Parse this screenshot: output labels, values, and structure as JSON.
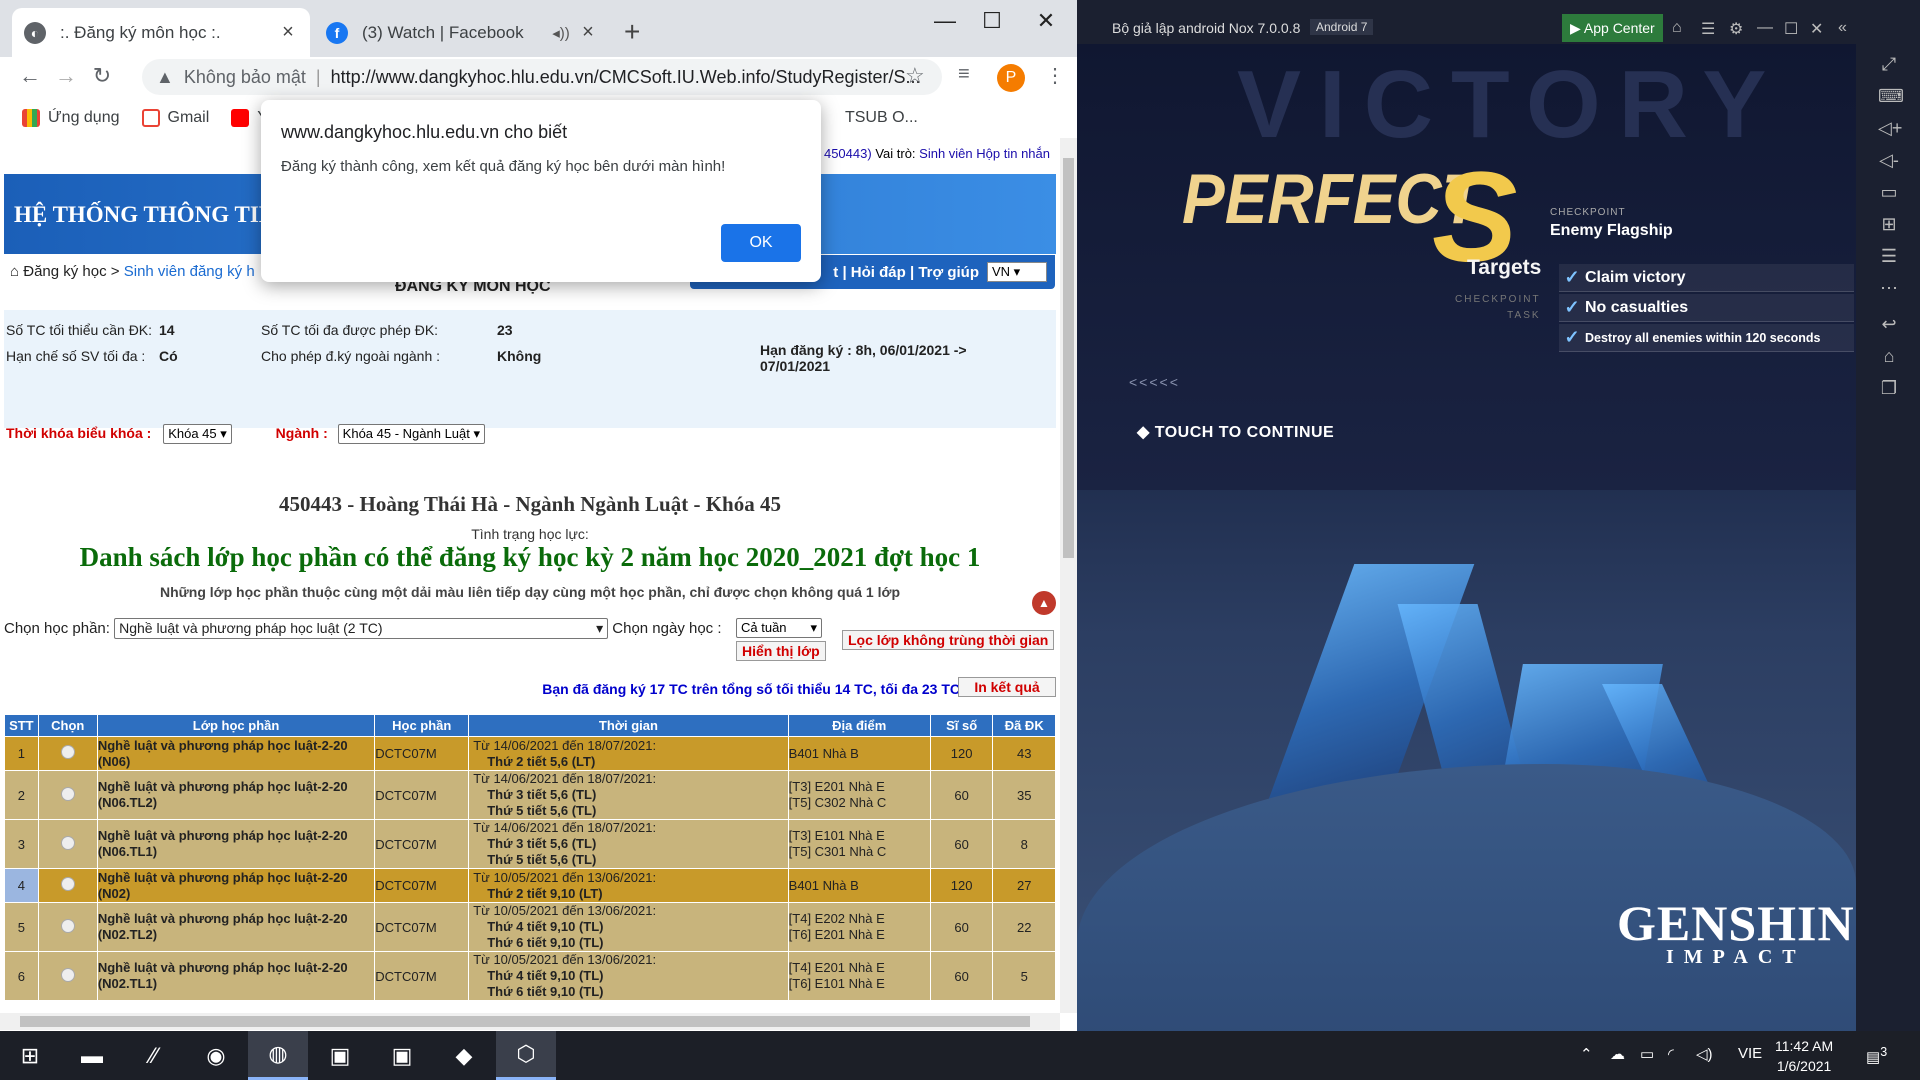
{
  "browser": {
    "tabs": [
      {
        "title": ":. Đăng ký môn học :.",
        "icon": "page-icon"
      },
      {
        "title": "(3) Watch | Facebook",
        "icon": "facebook-icon"
      }
    ],
    "omnibox": {
      "security": "Không bảo mật",
      "url": "http://www.dangkyhoc.hlu.edu.vn/CMCSoft.IU.Web.info/StudyRegister/S..."
    },
    "profile_initial": "P",
    "bookmarks": [
      {
        "label": "Ứng dụng",
        "icon": "apps-grid-icon"
      },
      {
        "label": "Gmail",
        "icon": "gmail-icon"
      },
      {
        "label": "Y",
        "icon": "youtube-icon"
      }
    ],
    "bookmark_tail": "TSUB O..."
  },
  "dialog": {
    "host": "www.dangkyhoc.hlu.edu.vn cho biết",
    "message": "Đăng ký thành công, xem kết quả đăng ký học bên dưới màn hình!",
    "ok": "OK"
  },
  "page": {
    "header_info_id": "450443)",
    "header_role_label": "Vai trò:",
    "header_role": "Sinh viên",
    "header_inbox": "Hộp tin nhắn",
    "banner_title": "HỆ THỐNG THÔNG TIN",
    "menu": "t | Hỏi đáp | Trợ giúp",
    "lang": "VN",
    "breadcrumb_home": "Đăng ký học",
    "breadcrumb_link": "Sinh viên đăng ký h",
    "title": "ĐĂNG KÝ MÔN HỌC",
    "min_credits_label": "Số TC tối thiểu cần ĐK:",
    "min_credits": "14",
    "max_credits_label": "Số TC tối đa được phép ĐK:",
    "max_credits": "23",
    "limit_label": "Hạn chế số SV tối đa :",
    "limit": "Có",
    "outside_label": "Cho phép đ.ký ngoài ngành :",
    "outside": "Không",
    "deadline": "Hạn đăng ký : 8h, 06/01/2021 ->",
    "deadline2": "07/01/2021",
    "timetable_label": "Thời khóa biểu khóa :",
    "timetable_value": "Khóa 45",
    "major_label": "Ngành :",
    "major_value": "Khóa 45 - Ngành Luật",
    "student": "450443 - Hoàng Thái Hà - Ngành Ngành Luật - Khóa 45",
    "standing": "Tình trạng học lực:",
    "list_title": "Danh sách lớp học phần có thể đăng ký học kỳ 2 năm học 2020_2021 đợt học 1",
    "note": "Những lớp học phần thuộc cùng một dải màu liên tiếp dạy cùng một học phần, chỉ được chọn không quá 1 lớp",
    "choose_course_label": "Chọn học phần:",
    "choose_course_value": "Nghề luật và phương pháp học luật (2 TC)",
    "choose_day_label": "Chọn ngày học :",
    "choose_day_value": "Cả tuần",
    "show_btn": "Hiển thị lớp",
    "filter_btn": "Lọc lớp không trùng thời gian",
    "summary": "Bạn đã đăng ký 17 TC trên tổng số tối thiểu 14 TC, tối đa 23 TC",
    "print_btn": "In kết quả",
    "columns": [
      "STT",
      "Chọn",
      "Lớp học phần",
      "Học phần",
      "Thời gian",
      "Địa điểm",
      "Sĩ số",
      "Đã ĐK"
    ],
    "rows": [
      {
        "stt": "1",
        "lop": "Nghề luật và phương pháp học luật-2-20 (N06)",
        "hp": "DCTC07M",
        "tg1": "Từ 14/06/2021 đến 18/07/2021:",
        "tg2": "Thứ 2 tiết 5,6 (LT)",
        "tg3": "",
        "dd1": "B401 Nhà B",
        "dd2": "",
        "siso": "120",
        "dadk": "43",
        "style": "orange"
      },
      {
        "stt": "2",
        "lop": "Nghề luật và phương pháp học luật-2-20 (N06.TL2)",
        "hp": "DCTC07M",
        "tg1": "Từ 14/06/2021 đến 18/07/2021:",
        "tg2": "Thứ 3 tiết 5,6 (TL)",
        "tg3": "Thứ 5 tiết 5,6 (TL)",
        "dd1": "[T3] E201 Nhà E",
        "dd2": "[T5] C302 Nhà C",
        "siso": "60",
        "dadk": "35",
        "style": "tan"
      },
      {
        "stt": "3",
        "lop": "Nghề luật và phương pháp học luật-2-20 (N06.TL1)",
        "hp": "DCTC07M",
        "tg1": "Từ 14/06/2021 đến 18/07/2021:",
        "tg2": "Thứ 3 tiết 5,6 (TL)",
        "tg3": "Thứ 5 tiết 5,6 (TL)",
        "dd1": "[T3] E101 Nhà E",
        "dd2": "[T5] C301 Nhà C",
        "siso": "60",
        "dadk": "8",
        "style": "tan"
      },
      {
        "stt": "4",
        "lop": "Nghề luật và phương pháp học luật-2-20 (N02)",
        "hp": "DCTC07M",
        "tg1": "Từ 10/05/2021 đến 13/06/2021:",
        "tg2": "Thứ 2 tiết 9,10 (LT)",
        "tg3": "",
        "dd1": "B401 Nhà B",
        "dd2": "",
        "siso": "120",
        "dadk": "27",
        "style": "orange-blue"
      },
      {
        "stt": "5",
        "lop": "Nghề luật và phương pháp học luật-2-20 (N02.TL2)",
        "hp": "DCTC07M",
        "tg1": "Từ 10/05/2021 đến 13/06/2021:",
        "tg2": "Thứ 4 tiết 9,10 (TL)",
        "tg3": "Thứ 6 tiết 9,10 (TL)",
        "dd1": "[T4] E202 Nhà E",
        "dd2": "[T6] E201 Nhà E",
        "siso": "60",
        "dadk": "22",
        "style": "tan"
      },
      {
        "stt": "6",
        "lop": "Nghề luật và phương pháp học luật-2-20 (N02.TL1)",
        "hp": "DCTC07M",
        "tg1": "Từ 10/05/2021 đến 13/06/2021:",
        "tg2": "Thứ 4 tiết 9,10 (TL)",
        "tg3": "Thứ 6 tiết 9,10 (TL)",
        "dd1": "[T4] E201 Nhà E",
        "dd2": "[T6] E101 Nhà E",
        "siso": "60",
        "dadk": "5",
        "style": "tan"
      }
    ]
  },
  "nox": {
    "title": "Bộ giả lập android Nox 7.0.0.8",
    "android": "Android 7",
    "app_center": "App Center"
  },
  "game": {
    "bg_word": "VICTORY",
    "perfect": "PERFECT",
    "rank": "S",
    "checkpoint_label": "CHECKPOINT",
    "checkpoint_value": "Enemy Flagship",
    "targets": "Targets",
    "cp_task1": "CHECKPOINT",
    "cp_task2": "TASK",
    "tasks": [
      "Claim victory",
      "No casualties",
      "Destroy all enemies within 120 seconds"
    ],
    "arrows": "<<<<<",
    "touch": "TOUCH TO CONTINUE",
    "logo1": "GENSHIN",
    "logo2": "IMPACT"
  },
  "taskbar": {
    "lang": "VIE",
    "time": "11:42 AM",
    "date": "1/6/2021",
    "notif": "3"
  },
  "colors": {
    "banner": "#2a76d2",
    "row_orange": "#c89a2a",
    "row_tan": "#c8b47c",
    "title_green": "#0a6b0a",
    "gold": "#f2c94c"
  }
}
